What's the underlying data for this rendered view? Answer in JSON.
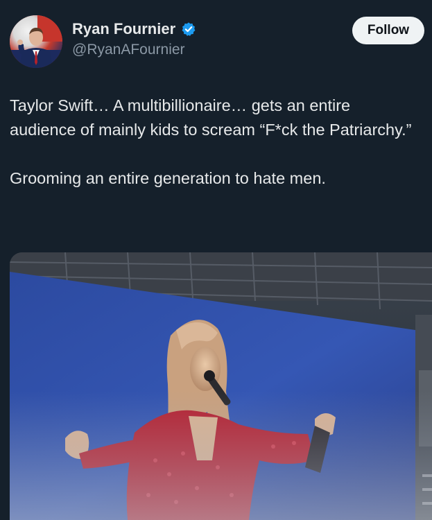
{
  "author": {
    "display_name": "Ryan Fournier",
    "handle": "@RyanAFournier",
    "verified": true,
    "avatar_icon": "profile-photo",
    "verified_icon": "verified-badge-icon"
  },
  "actions": {
    "follow_label": "Follow"
  },
  "tweet": {
    "paragraph1": "Taylor Swift… A multibillionaire… gets an entire audience of mainly kids to scream “F*ck the Patriarchy.”",
    "paragraph2": "Grooming an entire generation to hate men."
  },
  "media": {
    "type": "photo",
    "subject": "concert-screen-photo"
  },
  "colors": {
    "background": "#15202b",
    "text": "#e7e9ea",
    "secondary_text": "#8b98a5",
    "verified": "#1d9bf0",
    "follow_bg": "#eff3f4"
  }
}
